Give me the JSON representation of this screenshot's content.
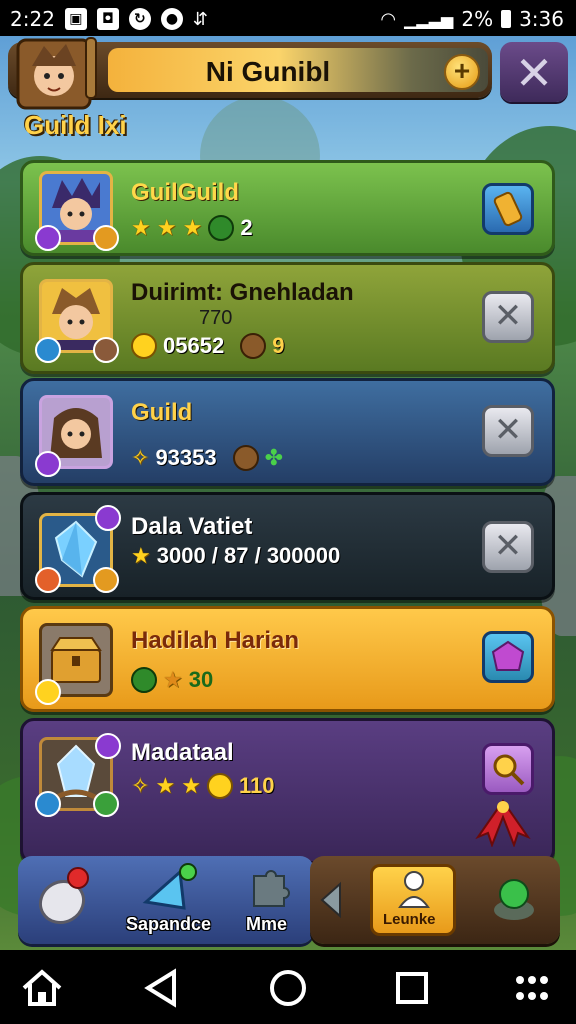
{
  "status_bar": {
    "time_left": "2:22",
    "battery_percent": "2%",
    "time_right": "3:36"
  },
  "header": {
    "title": "Ni Gunibl",
    "plus_symbol": "+",
    "close_symbol": "✕"
  },
  "section": {
    "title": "Guild Ixi"
  },
  "cards": [
    {
      "title": "GuilGuild",
      "stars": "★ ★ ★",
      "stat_value": "2",
      "action_icon": "scroll-icon",
      "bg": "#5a9a3c"
    },
    {
      "title": "Duirimt: Gnehladan",
      "subtitle": "770",
      "stat_value": "05652",
      "stat_value_2": "9",
      "action_symbol": "✕",
      "bg": "#6d8a2a"
    },
    {
      "title": "Guild",
      "stat_value": "93353",
      "action_symbol": "✕",
      "bg": "#2f5a8a"
    },
    {
      "title": "Dala Vatiet",
      "stat_value": "3000 / 87 / 300000",
      "action_symbol": "✕",
      "bg": "#27323a"
    },
    {
      "title": "Hadilah Harian",
      "stat_value": "30",
      "action_icon": "gem-icon",
      "bg": "#f0b232"
    },
    {
      "title": "Madataal",
      "stars": "★ ★",
      "stat_value": "110",
      "action_icon": "magnifier-ribbon-icon",
      "bg": "#4a3468"
    }
  ],
  "bottom_nav": {
    "items": [
      {
        "label": "",
        "icon": "potion-icon"
      },
      {
        "label": "Sapandce",
        "icon": "arrow-crystal-icon"
      },
      {
        "label": "Mme",
        "icon": "puzzle-icon"
      }
    ],
    "right_items": [
      {
        "label": "Leunke",
        "icon": "character-icon"
      },
      {
        "label": "",
        "icon": "green-orb-icon"
      }
    ]
  },
  "system_nav": {
    "items": [
      "home-icon",
      "back-icon",
      "circle-home-icon",
      "recents-icon",
      "apps-icon"
    ]
  }
}
